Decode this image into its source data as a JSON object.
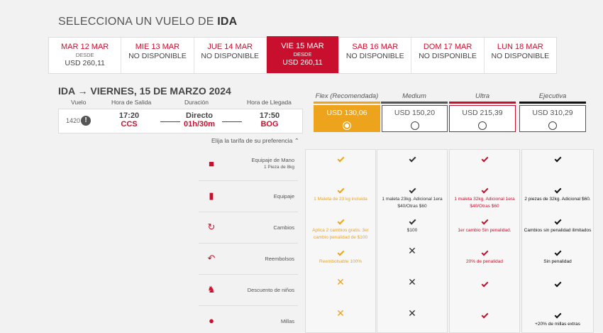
{
  "header": {
    "title_prefix": "SELECCIONA UN VUELO DE ",
    "title_bold": "IDA"
  },
  "dates": [
    {
      "label": "MAR 12 MAR",
      "desde": "DESDE",
      "value": "USD 260,11",
      "selected": false
    },
    {
      "label": "MIE 13 MAR",
      "desde": "",
      "value": "NO DISPONIBLE",
      "selected": false
    },
    {
      "label": "JUE 14 MAR",
      "desde": "",
      "value": "NO DISPONIBLE",
      "selected": false
    },
    {
      "label": "VIE 15 MAR",
      "desde": "DESDE",
      "value": "USD 260,11",
      "selected": true
    },
    {
      "label": "SAB 16 MAR",
      "desde": "",
      "value": "NO DISPONIBLE",
      "selected": false
    },
    {
      "label": "DOM 17 MAR",
      "desde": "",
      "value": "NO DISPONIBLE",
      "selected": false
    },
    {
      "label": "LUN 18 MAR",
      "desde": "",
      "value": "NO DISPONIBLE",
      "selected": false
    }
  ],
  "flight": {
    "title": "IDA → VIERNES, 15 DE MARZO 2024",
    "headers": {
      "vuelo": "Vuelo",
      "salida": "Hora de Salida",
      "duracion": "Duración",
      "llegada": "Hora de Llegada"
    },
    "number": "1420",
    "dep_time": "17:20",
    "dep_code": "CCS",
    "duration_type": "Directo",
    "duration": "01h/30m",
    "arr_time": "17:50",
    "arr_code": "BOG"
  },
  "elija": "Elija la tarifa de su preferencia ⌃",
  "fares": [
    {
      "name": "Flex (Recomendada)",
      "price": "USD 130,06",
      "color": "#eda41c"
    },
    {
      "name": "Medium",
      "price": "USD 150,20",
      "color": "#555555"
    },
    {
      "name": "Ultra",
      "price": "USD 215,39",
      "color": "#c8102e"
    },
    {
      "name": "Ejecutiva",
      "price": "USD 310,29",
      "color": "#111111"
    }
  ],
  "features": [
    {
      "label": "Equipaje de Mano",
      "sub": "1 Pieza de 8kg",
      "icon": "carry-on-icon"
    },
    {
      "label": "Equipaje",
      "sub": "",
      "icon": "luggage-icon"
    },
    {
      "label": "Cambios",
      "sub": "",
      "icon": "changes-icon"
    },
    {
      "label": "Reembolsos",
      "sub": "",
      "icon": "refund-icon"
    },
    {
      "label": "Descuento de niños",
      "sub": "",
      "icon": "child-icon"
    },
    {
      "label": "Millas",
      "sub": "",
      "icon": "miles-icon"
    }
  ],
  "matrix": {
    "flex": [
      {
        "mark": "check",
        "text": ""
      },
      {
        "mark": "check",
        "text": "1 Maleta de 23 kg incluida"
      },
      {
        "mark": "check",
        "text": "Aplica 2 cambios gratis. 3er cambio penalidad de $100"
      },
      {
        "mark": "check",
        "text": "Reembolsable 100%"
      },
      {
        "mark": "x",
        "text": ""
      },
      {
        "mark": "x",
        "text": ""
      }
    ],
    "medium": [
      {
        "mark": "check",
        "text": ""
      },
      {
        "mark": "check",
        "text": "1 maleta 23kg. Adicional 1era $40/Otras $60"
      },
      {
        "mark": "check",
        "text": "$100"
      },
      {
        "mark": "x",
        "text": ""
      },
      {
        "mark": "x",
        "text": ""
      },
      {
        "mark": "x",
        "text": ""
      }
    ],
    "ultra": [
      {
        "mark": "check",
        "text": ""
      },
      {
        "mark": "check",
        "text": "1 maleta 32kg. Adicional 1era $40/Otras $60"
      },
      {
        "mark": "check",
        "text": "1er cambio Sin penalidad."
      },
      {
        "mark": "check",
        "text": "20% de penalidad"
      },
      {
        "mark": "check",
        "text": ""
      },
      {
        "mark": "check",
        "text": ""
      }
    ],
    "ejecutiva": [
      {
        "mark": "check",
        "text": ""
      },
      {
        "mark": "check",
        "text": "2 piezas de 32kg. Adicional $60."
      },
      {
        "mark": "check",
        "text": "Cambios sin penalidad ilimitados"
      },
      {
        "mark": "check",
        "text": "Sin penalidad"
      },
      {
        "mark": "check",
        "text": ""
      },
      {
        "mark": "check",
        "text": "+20% de millas extras"
      }
    ]
  }
}
